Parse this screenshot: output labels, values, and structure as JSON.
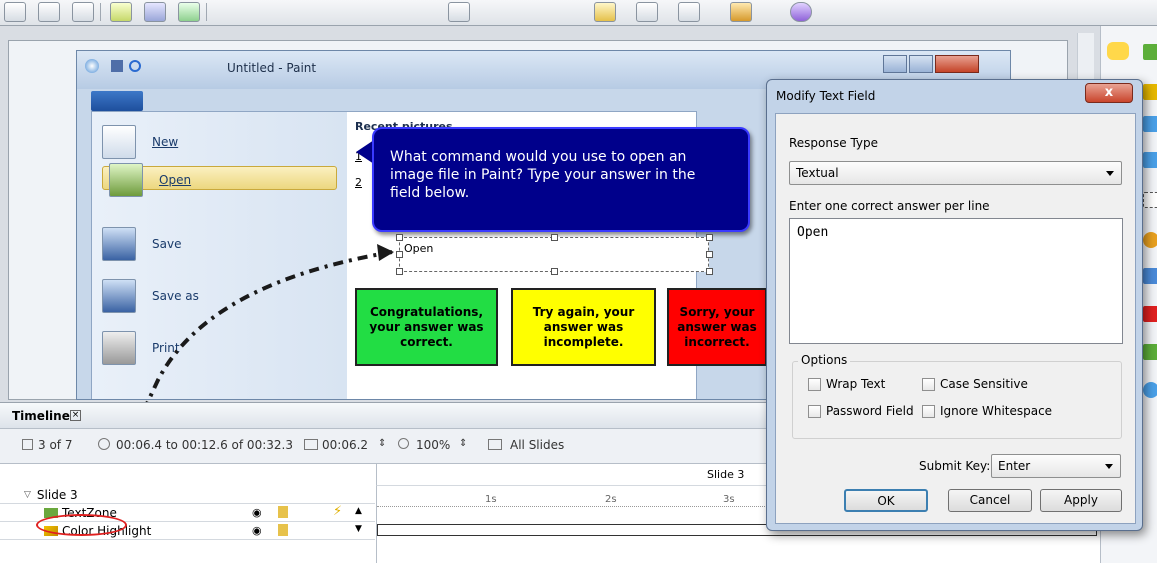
{
  "paint": {
    "title": "Untitled - Paint",
    "menu_items": [
      {
        "label": "New"
      },
      {
        "label": "Open"
      },
      {
        "label": "Save"
      },
      {
        "label": "Save as"
      },
      {
        "label": "Print"
      }
    ],
    "recent_header": "Recent pictures",
    "recent_numbers": [
      "1",
      "2"
    ]
  },
  "callout": {
    "text": "What command would you use to open an image file in Paint? Type your answer in the field below."
  },
  "answer_field": {
    "value": "Open"
  },
  "results": [
    {
      "text": "Congratulations, your answer was correct.",
      "color": "#22dd44"
    },
    {
      "text": "Try again, your answer was incomplete.",
      "color": "#ffff00"
    },
    {
      "text": "Sorry, your answer was incorrect.",
      "color": "#ff0000"
    }
  ],
  "timeline": {
    "title": "Timeline",
    "slide_pos": "3 of 7",
    "time_range": "00:06.4 to 00:12.6 of 00:32.3",
    "duration": "00:06.2",
    "zoom": "100%",
    "all_slides": "All Slides",
    "slide_label": "Slide 3",
    "group": "Slide 3",
    "rows": [
      {
        "label": "TextZone"
      },
      {
        "label": "Color Highlight"
      }
    ],
    "ticks": [
      "1s",
      "2s",
      "3s"
    ]
  },
  "dialog": {
    "title": "Modify Text Field",
    "close": "x",
    "response_type_label": "Response Type",
    "response_type_value": "Textual",
    "answers_label": "Enter one correct answer per line",
    "answers_value": "Open",
    "options_label": "Options",
    "options": {
      "wrap_text": "Wrap Text",
      "case_sensitive": "Case Sensitive",
      "password_field": "Password Field",
      "ignore_whitespace": "Ignore Whitespace"
    },
    "submit_key_label": "Submit Key:",
    "submit_key_value": "Enter",
    "ok": "OK",
    "cancel": "Cancel",
    "apply": "Apply"
  }
}
